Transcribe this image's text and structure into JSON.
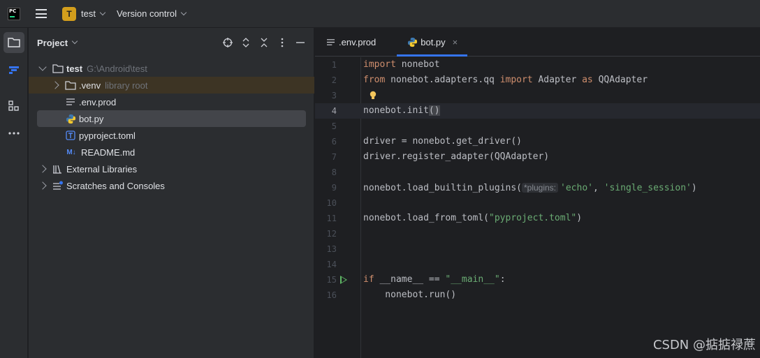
{
  "titlebar": {
    "app_logo_text": "PC",
    "project_badge": "T",
    "project_name": "test",
    "vcs_label": "Version control"
  },
  "toolstrip": {
    "items": [
      {
        "icon": "folder-icon",
        "active": true
      },
      {
        "icon": "plugin-icon",
        "active": false
      },
      {
        "icon": "structure-icon",
        "active": false
      },
      {
        "icon": "more-icon",
        "active": false
      }
    ]
  },
  "project_panel": {
    "title": "Project",
    "actions": [
      "locate-icon",
      "expand-collapse-icon",
      "collapse-all-icon",
      "more-options-icon",
      "minimize-icon"
    ],
    "tree": [
      {
        "label": "test",
        "hint": "G:\\Android\\test",
        "icon": "folder-icon",
        "expanded": true
      },
      {
        "label": ".venv",
        "hint": "library root",
        "icon": "folder-icon",
        "expanded": false
      },
      {
        "label": ".env.prod",
        "icon": "text-file-icon"
      },
      {
        "label": "bot.py",
        "icon": "python-file-icon",
        "selected": true
      },
      {
        "label": "pyproject.toml",
        "icon": "toml-file-icon"
      },
      {
        "label": "README.md",
        "icon": "markdown-file-icon"
      },
      {
        "label": "External Libraries",
        "icon": "libraries-icon",
        "expanded": false
      },
      {
        "label": "Scratches and Consoles",
        "icon": "scratches-icon",
        "expanded": false
      }
    ]
  },
  "editor": {
    "tabs": [
      {
        "label": ".env.prod",
        "icon": "text-file-icon",
        "active": false
      },
      {
        "label": "bot.py",
        "icon": "python-file-icon",
        "active": true,
        "close": "×"
      }
    ],
    "lines": {
      "n1": "1",
      "n2": "2",
      "n3": "3",
      "n4": "4",
      "n5": "5",
      "n6": "6",
      "n7": "7",
      "n8": "8",
      "n9": "9",
      "n10": "10",
      "n11": "11",
      "n12": "12",
      "n13": "13",
      "n14": "14",
      "n15": "15",
      "n16": "16",
      "l1_kw": "import",
      "l1_rest": " nonebot",
      "l2_kw": "from",
      "l2_mod": " nonebot.adapters.qq ",
      "l2_kw2": "import",
      "l2_name": " Adapter ",
      "l2_kw3": "as",
      "l2_alias": " QQAdapter",
      "l4_call": "nonebot.init",
      "l4_parens": "()",
      "l6": "driver = nonebot.get_driver()",
      "l7": "driver.register_adapter(QQAdapter)",
      "l9_call": "nonebot.load_builtin_plugins(",
      "l9_hint": "*plugins:",
      "l9_arg1": "'echo'",
      "l9_sep": ", ",
      "l9_arg2": "'single_session'",
      "l9_end": ")",
      "l11_call": "nonebot.load_from_toml(",
      "l11_arg": "\"pyproject.toml\"",
      "l11_end": ")",
      "l15_kw": "if",
      "l15_mid": " __name__ == ",
      "l15_str": "\"__main__\"",
      "l15_end": ":",
      "l16": "    nonebot.run()"
    },
    "current_line": 4
  },
  "watermark": "CSDN @掂掂禄蔗"
}
